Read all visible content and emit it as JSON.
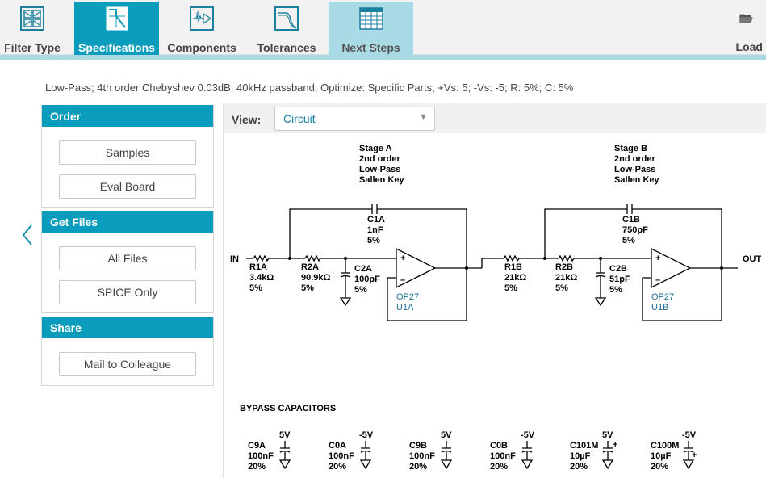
{
  "nav": {
    "tabs": [
      {
        "label": "Filter Type"
      },
      {
        "label": "Specifications"
      },
      {
        "label": "Components"
      },
      {
        "label": "Tolerances"
      },
      {
        "label": "Next Steps"
      }
    ],
    "load_label": "Load"
  },
  "summary": "Low-Pass; 4th order Chebyshev 0.03dB; 40kHz passband; Optimize: Specific Parts; +Vs: 5; -Vs: -5; R: 5%; C: 5%",
  "order": {
    "title": "Order",
    "samples": "Samples",
    "eval_board": "Eval Board"
  },
  "get_files": {
    "title": "Get Files",
    "all_files": "All Files",
    "spice_only": "SPICE Only"
  },
  "share": {
    "title": "Share",
    "mail": "Mail to Colleague"
  },
  "view": {
    "label": "View:",
    "selected": "Circuit"
  },
  "schematic": {
    "in_label": "IN",
    "out_label": "OUT",
    "stage_a": {
      "line1": "Stage A",
      "line2": "2nd order",
      "line3": "Low-Pass",
      "line4": "Sallen Key"
    },
    "stage_b": {
      "line1": "Stage B",
      "line2": "2nd order",
      "line3": "Low-Pass",
      "line4": "Sallen Key"
    },
    "c1a": {
      "name": "C1A",
      "value": "1nF",
      "tol": "5%"
    },
    "r1a": {
      "name": "R1A",
      "value": "3.4kΩ",
      "tol": "5%"
    },
    "r2a": {
      "name": "R2A",
      "value": "90.9kΩ",
      "tol": "5%"
    },
    "c2a": {
      "name": "C2A",
      "value": "100pF",
      "tol": "5%"
    },
    "u1a": {
      "part": "OP27",
      "ref": "U1A"
    },
    "c1b": {
      "name": "C1B",
      "value": "750pF",
      "tol": "5%"
    },
    "r1b": {
      "name": "R1B",
      "value": "21kΩ",
      "tol": "5%"
    },
    "r2b": {
      "name": "R2B",
      "value": "21kΩ",
      "tol": "5%"
    },
    "c2b": {
      "name": "C2B",
      "value": "51pF",
      "tol": "5%"
    },
    "u1b": {
      "part": "OP27",
      "ref": "U1B"
    },
    "opamp_plus": "+",
    "opamp_minus": "–",
    "bypass_title": "BYPASS CAPACITORS",
    "bypass": [
      {
        "name": "C9A",
        "value": "100nF",
        "tol": "20%",
        "rail": "5V"
      },
      {
        "name": "C0A",
        "value": "100nF",
        "tol": "20%",
        "rail": "-5V"
      },
      {
        "name": "C9B",
        "value": "100nF",
        "tol": "20%",
        "rail": "5V"
      },
      {
        "name": "C0B",
        "value": "100nF",
        "tol": "20%",
        "rail": "-5V"
      },
      {
        "name": "C101M",
        "value": "10µF",
        "tol": "20%",
        "rail": "5V",
        "polar": "+"
      },
      {
        "name": "C100M",
        "value": "10µF",
        "tol": "20%",
        "rail": "-5V",
        "polar": "+"
      }
    ]
  }
}
